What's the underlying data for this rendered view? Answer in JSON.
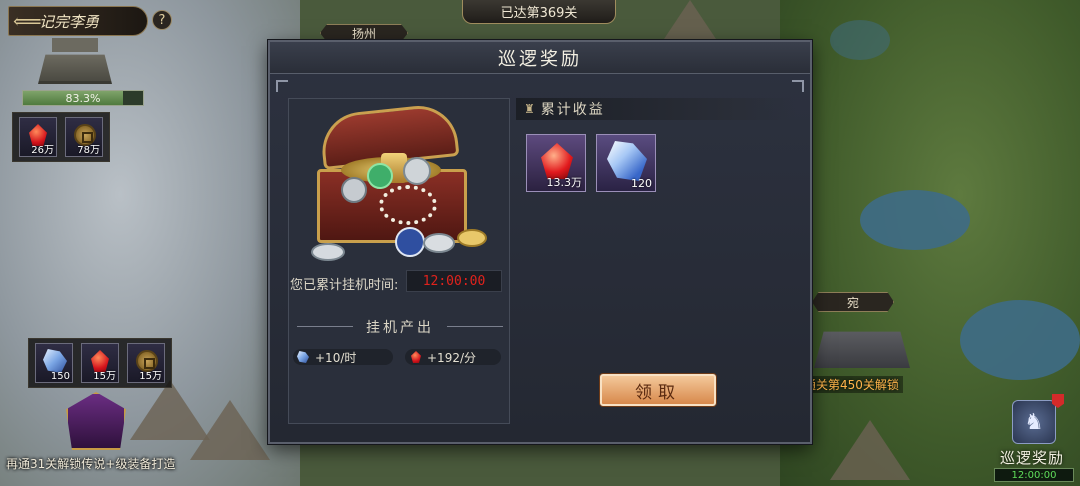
{
  "header": {
    "back_label": "记完李勇",
    "help_label": "?",
    "stage_progress": "已达第369关"
  },
  "map": {
    "city_left": "扬州",
    "city_right": "宛",
    "fort_progress": "83.3%",
    "fort_progress_value": 0.833
  },
  "left_resources_top": [
    {
      "icon": "red-gem-icon",
      "qty": "26万"
    },
    {
      "icon": "copper-coin-icon",
      "qty": "78万"
    }
  ],
  "left_resources_bottom": [
    {
      "icon": "blue-crystal-icon",
      "qty": "150"
    },
    {
      "icon": "red-gem-icon",
      "qty": "15万"
    },
    {
      "icon": "copper-coin-icon",
      "qty": "15万"
    }
  ],
  "bottom_note": "再通31关解锁传说+级装备打造",
  "right_unlock_note": "通关第450关解锁",
  "patrol_shortcut": {
    "label": "巡逻奖励",
    "timer": "12:00:00"
  },
  "dialog": {
    "title": "巡逻奖励",
    "idle_time_label": "您已累计挂机时间:",
    "idle_time_value": "12:00:00",
    "output_title": "挂机产出",
    "rates": [
      {
        "icon": "blue-crystal-icon",
        "text": "+10/时"
      },
      {
        "icon": "red-gem-icon",
        "text": "+192/分"
      }
    ],
    "accumulated_title": "累计收益",
    "rewards": [
      {
        "icon": "red-gem-icon",
        "qty": "13.3万"
      },
      {
        "icon": "blue-crystal-icon",
        "qty": "120"
      }
    ],
    "claim_label": "领取"
  },
  "colors": {
    "timer_red": "#e0221c",
    "claim_button": "#e8a36c",
    "panel_bg": "#2a2f3b"
  }
}
